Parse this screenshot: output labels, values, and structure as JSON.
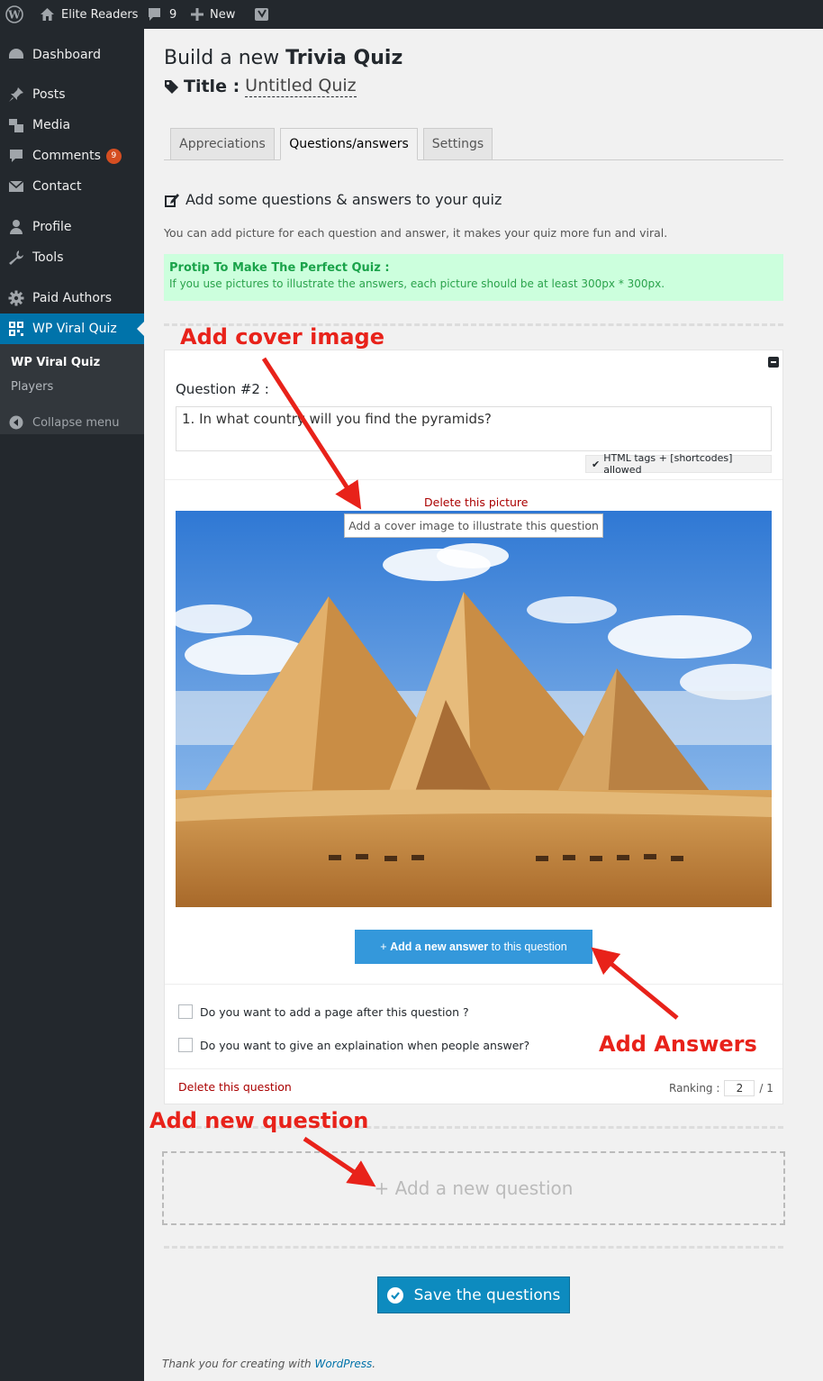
{
  "admin_bar": {
    "site_name": "Elite Readers",
    "comments_count": "9",
    "new_label": "New"
  },
  "sidebar": {
    "items": [
      {
        "label": "Dashboard",
        "icon": "dashboard-icon"
      },
      {
        "label": "Posts",
        "icon": "pin-icon"
      },
      {
        "label": "Media",
        "icon": "media-icon"
      },
      {
        "label": "Comments",
        "icon": "comment-icon",
        "badge": "9"
      },
      {
        "label": "Contact",
        "icon": "mail-icon"
      },
      {
        "label": "Profile",
        "icon": "user-icon"
      },
      {
        "label": "Tools",
        "icon": "wrench-icon"
      },
      {
        "label": "Paid Authors",
        "icon": "gear-icon"
      },
      {
        "label": "WP Viral Quiz",
        "icon": "qr-icon"
      }
    ],
    "submenu": [
      {
        "label": "WP Viral Quiz"
      },
      {
        "label": "Players"
      }
    ],
    "collapse_label": "Collapse menu"
  },
  "page": {
    "title_prefix": "Build a new ",
    "title_strong": "Trivia Quiz",
    "title_label": "Title :",
    "quiz_title": "Untitled Quiz"
  },
  "tabs": [
    {
      "label": "Appreciations"
    },
    {
      "label": "Questions/answers"
    },
    {
      "label": "Settings"
    }
  ],
  "section": {
    "heading": "Add some questions & answers to your quiz",
    "description": "You can add picture for each question and answer, it makes your quiz more fun and viral.",
    "protip_title": "Protip To Make The Perfect Quiz :",
    "protip_text": "If you use pictures to illustrate the answers, each picture should be at least 300px * 300px."
  },
  "question": {
    "label": "Question #2 :",
    "text": "1. In what country will you find the pyramids?",
    "html_note": "HTML tags + [shortcodes] allowed",
    "delete_picture": "Delete this picture",
    "cover_tooltip": "Add a cover image to illustrate this question",
    "add_answer_prefix": "+ ",
    "add_answer_bold": "Add a new answer",
    "add_answer_suffix": " to this question",
    "option_page": "Do you want to add a page after this question ?",
    "option_explanation": "Do you want to give an explaination when people answer?",
    "delete_question": "Delete this question",
    "ranking_label": "Ranking :",
    "ranking_value": "2",
    "ranking_total": "/ 1"
  },
  "add_question_label": "+ Add a new question",
  "save_label": "Save the questions",
  "footer": {
    "text": "Thank you for creating with ",
    "link": "WordPress",
    "end": "."
  },
  "annotations": {
    "cover": "Add cover image",
    "answers": "Add Answers",
    "new_question": "Add new question"
  },
  "colors": {
    "admin_bg": "#23282d",
    "accent": "#0073aa",
    "button_blue": "#3498db",
    "annotation_red": "#e8221a",
    "protip_bg": "#ccffdd"
  }
}
